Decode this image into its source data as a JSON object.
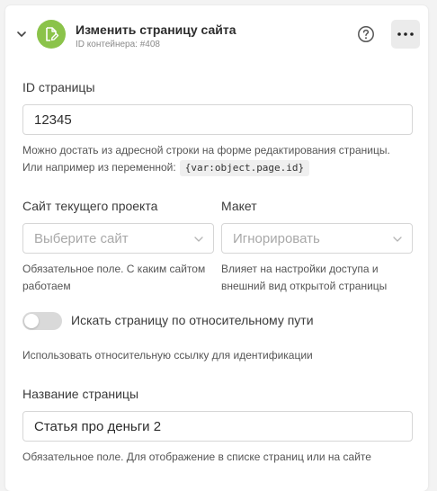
{
  "header": {
    "title": "Изменить страницу сайта",
    "subtitle": "ID контейнера: #408",
    "icons": {
      "collapse": "chevron-down-icon",
      "app": "page-edit-icon",
      "help": "help-circle-icon",
      "more": "more-horizontal-icon"
    }
  },
  "colors": {
    "accent": "#8bc34a",
    "more_button_bg": "#ebebeb",
    "toggle_off": "#d9d9d9"
  },
  "page_id": {
    "label": "ID страницы",
    "value": "12345",
    "hint_line1": "Можно достать из адресной строки на форме редактирования страницы.",
    "hint_line2": "Или например из переменной:",
    "hint_code": "{var:object.page.id}"
  },
  "site": {
    "label": "Сайт текущего проекта",
    "placeholder": "Выберите сайт",
    "hint": "Обязательное поле. С каким сайтом работаем"
  },
  "layout": {
    "label": "Макет",
    "placeholder": "Игнорировать",
    "hint": "Влияет на настройки доступа и внешний вид открытой страницы"
  },
  "relative_path": {
    "label": "Искать страницу по относительному пути",
    "enabled": false,
    "hint": "Использовать относительную ссылку для идентификации"
  },
  "page_name": {
    "label": "Название страницы",
    "value": "Статья про деньги 2",
    "hint": "Обязательное поле. Для отображение в списке страниц или на сайте"
  }
}
